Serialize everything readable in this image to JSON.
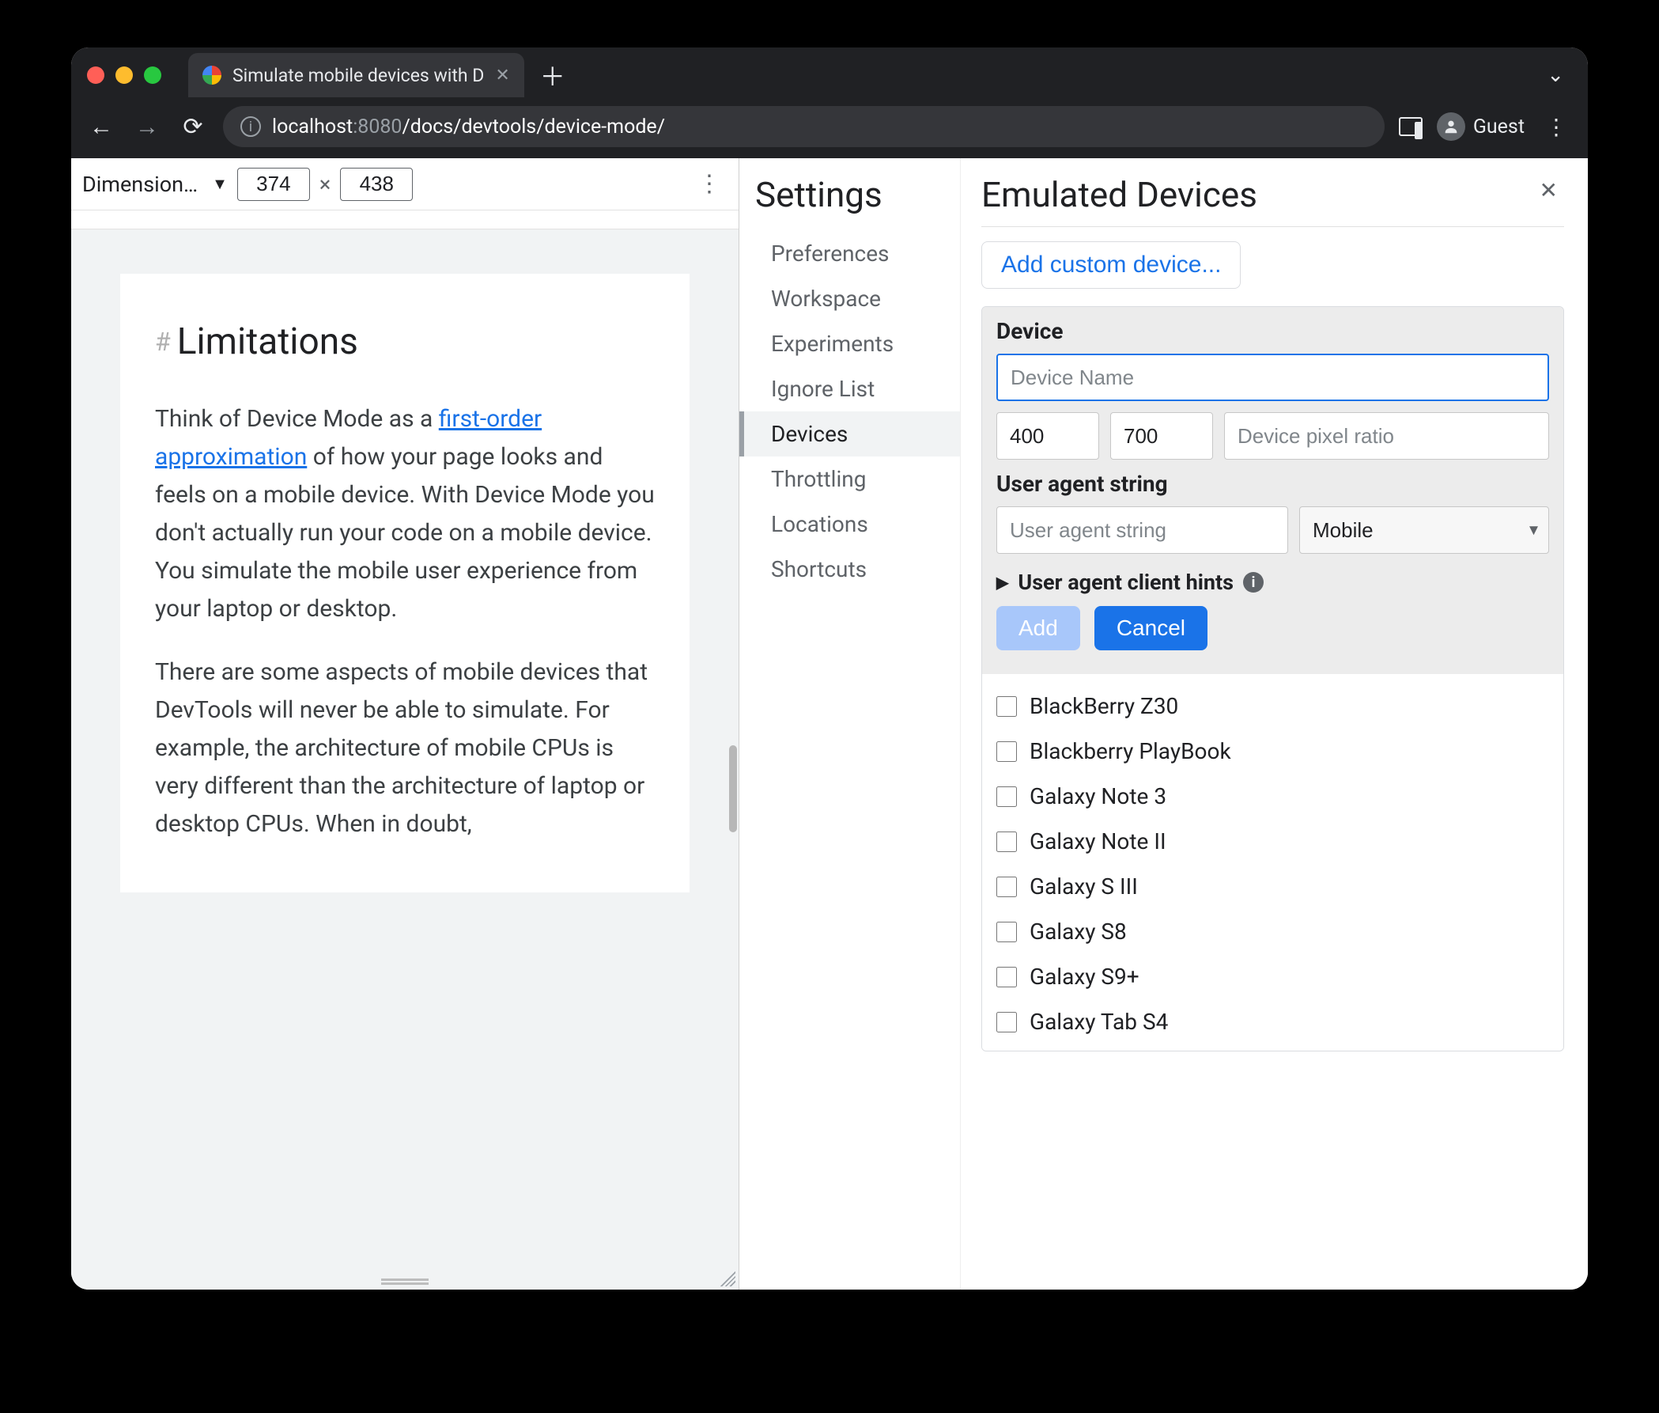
{
  "browser": {
    "tab_title": "Simulate mobile devices with D",
    "url_host": "localhost",
    "url_port": ":8080",
    "url_path": "/docs/devtools/device-mode/",
    "guest_label": "Guest"
  },
  "device_bar": {
    "dimensions_label": "Dimension…",
    "width": "374",
    "height": "438",
    "separator": "×"
  },
  "page": {
    "heading": "Limitations",
    "para1_pre": "Think of Device Mode as a ",
    "para1_link": "first-order approximation",
    "para1_post": " of how your page looks and feels on a mobile device. With Device Mode you don't actually run your code on a mobile device. You simulate the mobile user experience from your laptop or desktop.",
    "para2": "There are some aspects of mobile devices that DevTools will never be able to simulate. For example, the architecture of mobile CPUs is very different than the architecture of laptop or desktop CPUs. When in doubt,"
  },
  "settings": {
    "title": "Settings",
    "nav": {
      "preferences": "Preferences",
      "workspace": "Workspace",
      "experiments": "Experiments",
      "ignore_list": "Ignore List",
      "devices": "Devices",
      "throttling": "Throttling",
      "locations": "Locations",
      "shortcuts": "Shortcuts"
    },
    "panel_title": "Emulated Devices",
    "add_custom": "Add custom device...",
    "device_section": "Device",
    "device_name_placeholder": "Device Name",
    "width_value": "400",
    "height_value": "700",
    "dpr_placeholder": "Device pixel ratio",
    "ua_section": "User agent string",
    "ua_placeholder": "User agent string",
    "ua_type": "Mobile",
    "hints_label": "User agent client hints",
    "add_btn": "Add",
    "cancel_btn": "Cancel",
    "devices_list": [
      "BlackBerry Z30",
      "Blackberry PlayBook",
      "Galaxy Note 3",
      "Galaxy Note II",
      "Galaxy S III",
      "Galaxy S8",
      "Galaxy S9+",
      "Galaxy Tab S4"
    ]
  }
}
